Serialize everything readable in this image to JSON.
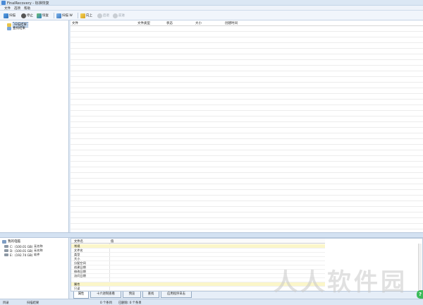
{
  "window": {
    "title": "FinalRecovery - 标准恢复"
  },
  "menu": [
    {
      "label": "文件"
    },
    {
      "label": "选项"
    },
    {
      "label": "帮助"
    }
  ],
  "toolbar": {
    "scan": "扫描",
    "stop": "停止",
    "recover": "恢复",
    "scan_w": "扫描 W",
    "up": "向上",
    "ext1": "后退",
    "ext2": "前进"
  },
  "tree": [
    {
      "label": "扫描结果",
      "selected": true
    },
    {
      "label": "查找结果",
      "selected": false
    }
  ],
  "file_list": {
    "columns": [
      "文件",
      "文件类型",
      "状态",
      "大小",
      "创建时间"
    ]
  },
  "drives": {
    "root": "我的电脑",
    "items": [
      {
        "letter": "C:",
        "size": "(100.01 GB)",
        "fs": "无名称"
      },
      {
        "letter": "D:",
        "size": "(100.01 GB)",
        "fs": "无名称"
      },
      {
        "letter": "E:",
        "size": "(192.74 GB)",
        "fs": "软件"
      }
    ]
  },
  "properties": {
    "headers": [
      "文件名",
      "值"
    ],
    "rows": [
      {
        "label": "常规",
        "group": true
      },
      {
        "label": "文件名",
        "group": false
      },
      {
        "label": "类型",
        "group": false
      },
      {
        "label": "大小",
        "group": false
      },
      {
        "label": "分配空间",
        "group": false
      },
      {
        "label": "创建日期",
        "group": false
      },
      {
        "label": "修改日期",
        "group": false
      },
      {
        "label": "访问日期",
        "group": false
      },
      {
        "label": "",
        "group": false
      },
      {
        "label": "属性",
        "group": true
      },
      {
        "label": "只读",
        "group": false
      }
    ]
  },
  "tabs": [
    {
      "label": "属性",
      "active": true
    },
    {
      "label": "十六进制查看",
      "active": false
    },
    {
      "label": "预览",
      "active": false
    },
    {
      "label": "查找",
      "active": false
    },
    {
      "label": "应用程序日志",
      "active": false
    }
  ],
  "status": {
    "left": "目录",
    "path": "扫描结果",
    "count": "0 个条目",
    "selected": "已删除: 0 个条目"
  },
  "watermark": "人人软件园",
  "colors": {
    "accent": "#4a8ad6",
    "group_row": "#fbf6c9",
    "help": "#3cbb5a"
  }
}
